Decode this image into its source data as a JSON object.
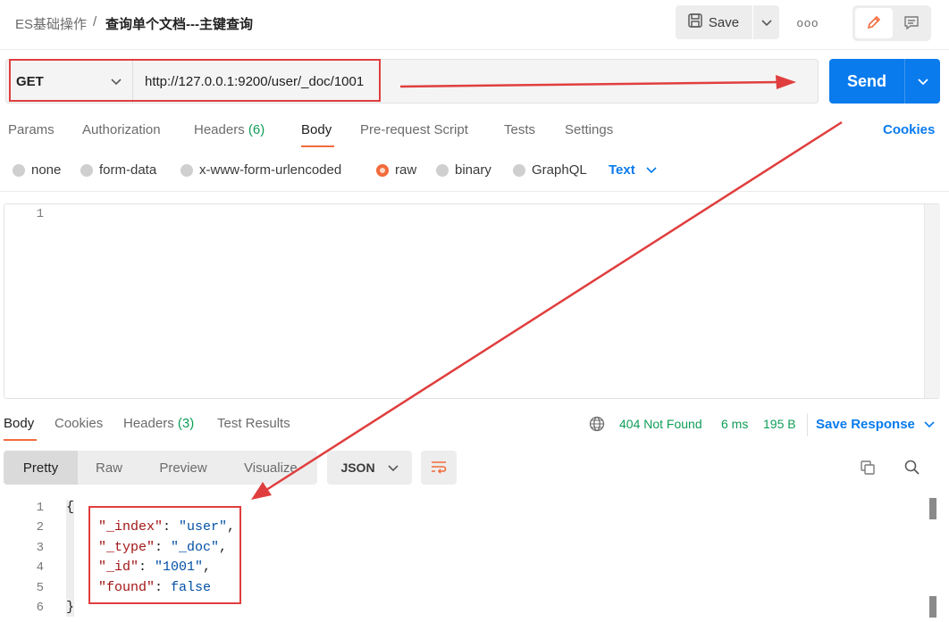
{
  "header": {
    "breadcrumb_parent": "ES基础操作",
    "breadcrumb_separator": "/",
    "breadcrumb_current": "查询单个文档---主键查询",
    "save_label": "Save",
    "more_label": "ooo"
  },
  "request": {
    "method": "GET",
    "url": "http://127.0.0.1:9200/user/_doc/1001",
    "send_label": "Send"
  },
  "request_tabs": {
    "params": "Params",
    "authorization": "Authorization",
    "headers": "Headers",
    "headers_count": "(6)",
    "body": "Body",
    "prerequest": "Pre-request Script",
    "tests": "Tests",
    "settings": "Settings",
    "active": "Body",
    "cookies": "Cookies"
  },
  "body_types": {
    "none": "none",
    "form_data": "form-data",
    "urlencoded": "x-www-form-urlencoded",
    "raw": "raw",
    "binary": "binary",
    "graphql": "GraphQL",
    "selected": "raw",
    "format": "Text"
  },
  "request_editor": {
    "line_numbers": [
      "1"
    ]
  },
  "response_tabs": {
    "body": "Body",
    "cookies": "Cookies",
    "headers": "Headers",
    "headers_count": "(3)",
    "test_results": "Test Results",
    "active": "Body"
  },
  "response_status": {
    "code": "404 Not Found",
    "time": "6 ms",
    "size": "195 B",
    "save_response": "Save Response"
  },
  "response_toolbar": {
    "pretty": "Pretty",
    "raw": "Raw",
    "preview": "Preview",
    "visualize": "Visualize",
    "active": "Pretty",
    "format": "JSON"
  },
  "response_body": {
    "line_numbers": [
      "1",
      "2",
      "3",
      "4",
      "5",
      "6"
    ],
    "open_brace": "{",
    "close_brace": "}",
    "fields": [
      {
        "key": "\"_index\"",
        "value": "\"user\"",
        "trail": ","
      },
      {
        "key": "\"_type\"",
        "value": "\"_doc\"",
        "trail": ","
      },
      {
        "key": "\"_id\"",
        "value": "\"1001\"",
        "trail": ","
      },
      {
        "key": "\"found\"",
        "value": "false",
        "trail": ""
      }
    ]
  },
  "colors": {
    "accent_orange": "#f26b3a",
    "send_blue": "#097bed",
    "status_green": "#0f9d58",
    "annotation_red": "#e03e3e"
  },
  "icons": {
    "save": "floppy-disk-icon",
    "edit": "pencil-icon",
    "comments": "comment-icon",
    "globe": "globe-icon",
    "wrap": "text-wrap-icon",
    "copy": "copy-icon",
    "search": "search-icon"
  }
}
